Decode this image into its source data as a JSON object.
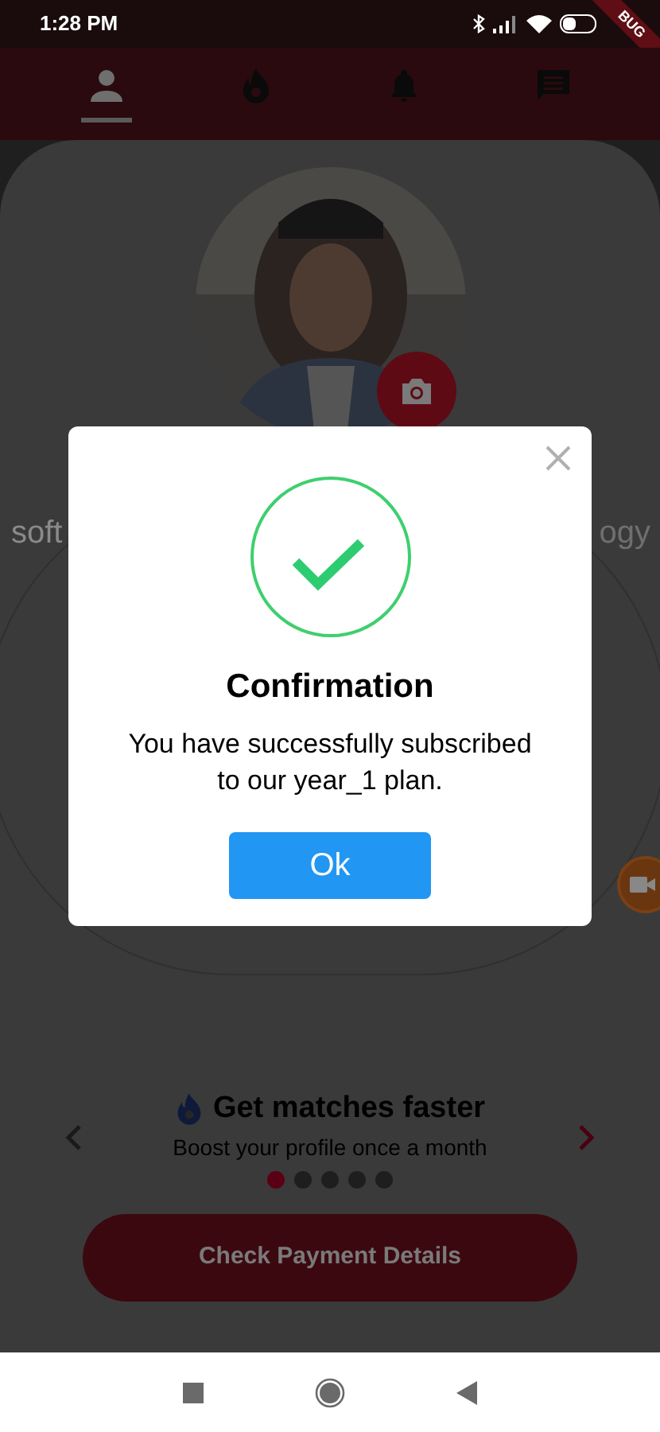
{
  "status_bar": {
    "time": "1:28 PM",
    "debug_banner": "BUG"
  },
  "tabs": [
    {
      "kind": "profile",
      "selected": true
    },
    {
      "kind": "boost",
      "selected": false
    },
    {
      "kind": "notifications",
      "selected": false
    },
    {
      "kind": "messages",
      "selected": false
    }
  ],
  "profile": {
    "text_left": "soft",
    "text_right": "ogy"
  },
  "dialog": {
    "title": "Confirmation",
    "message": "You have successfully subscribed to our year_1 plan.",
    "button": "Ok"
  },
  "carousel": {
    "title": "Get matches faster",
    "subtitle": "Boost your profile once a month",
    "dots": [
      {
        "selected": true
      },
      {
        "selected": false
      },
      {
        "selected": false
      },
      {
        "selected": false
      },
      {
        "selected": false
      }
    ]
  },
  "action_button": "Check Payment Details"
}
